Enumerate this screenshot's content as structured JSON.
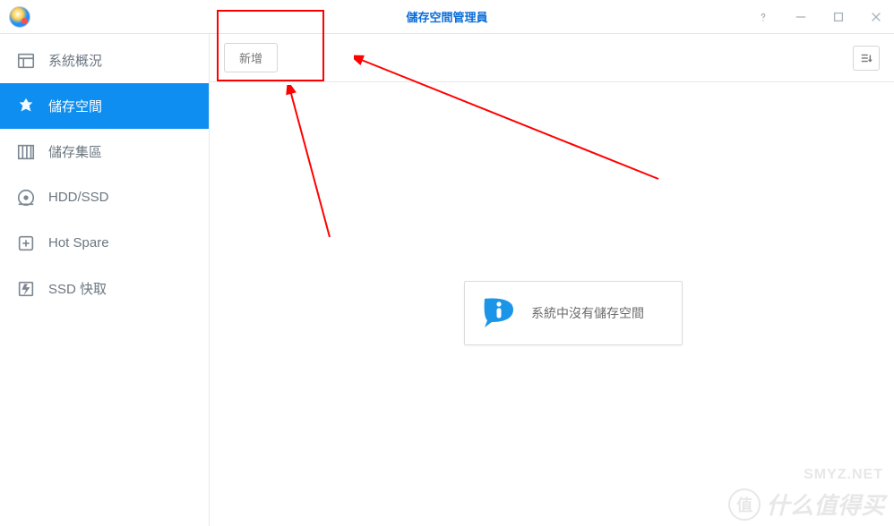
{
  "window": {
    "title": "儲存空間管理員"
  },
  "sidebar": {
    "items": [
      {
        "label": "系統概況"
      },
      {
        "label": "儲存空間"
      },
      {
        "label": "儲存集區"
      },
      {
        "label": "HDD/SSD"
      },
      {
        "label": "Hot Spare"
      },
      {
        "label": "SSD 快取"
      }
    ]
  },
  "toolbar": {
    "new_label": "新增"
  },
  "empty_state": {
    "message": "系統中沒有儲存空間"
  },
  "watermark": {
    "badge": "值",
    "text": "什么值得买",
    "site": "SMYZ.NET"
  }
}
